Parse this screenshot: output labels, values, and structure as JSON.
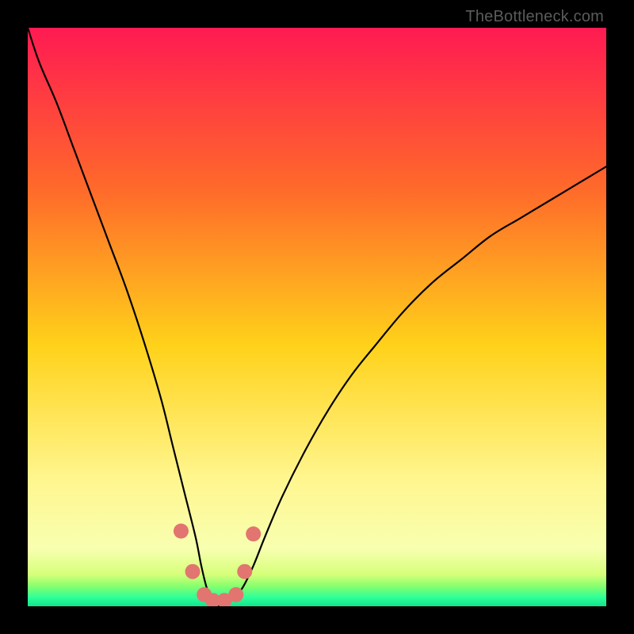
{
  "watermark": "TheBottleneck.com",
  "chart_data": {
    "type": "line",
    "title": "",
    "xlabel": "",
    "ylabel": "",
    "xlim": [
      0,
      100
    ],
    "ylim": [
      0,
      100
    ],
    "gradient_stops": [
      {
        "offset": 0,
        "color": "#ff1a52"
      },
      {
        "offset": 0.28,
        "color": "#ff6a2a"
      },
      {
        "offset": 0.55,
        "color": "#ffd21a"
      },
      {
        "offset": 0.78,
        "color": "#fff68f"
      },
      {
        "offset": 0.9,
        "color": "#f8ffb0"
      },
      {
        "offset": 0.945,
        "color": "#d7ff7a"
      },
      {
        "offset": 0.965,
        "color": "#88ff6e"
      },
      {
        "offset": 0.985,
        "color": "#2dff9a"
      },
      {
        "offset": 1.0,
        "color": "#10e58c"
      }
    ],
    "series": [
      {
        "name": "bottleneck-curve",
        "x": [
          0,
          2,
          5,
          8,
          11,
          14,
          17,
          20,
          23,
          25,
          27,
          29,
          30,
          31,
          32,
          33,
          34,
          35,
          37,
          39,
          41,
          44,
          48,
          52,
          56,
          60,
          65,
          70,
          75,
          80,
          85,
          90,
          95,
          100
        ],
        "values": [
          100,
          94,
          87,
          79,
          71,
          63,
          55,
          46,
          36,
          28,
          20,
          12,
          7,
          3,
          1,
          0,
          0,
          1,
          3,
          7,
          12,
          19,
          27,
          34,
          40,
          45,
          51,
          56,
          60,
          64,
          67,
          70,
          73,
          76
        ]
      },
      {
        "name": "dot-markers",
        "x": [
          26.5,
          28.5,
          30.5,
          32.0,
          34.0,
          36.0,
          37.5,
          39.0
        ],
        "values": [
          13.0,
          6.0,
          2.0,
          1.0,
          1.0,
          2.0,
          6.0,
          12.5
        ]
      }
    ],
    "marker_color": "#e2756f",
    "curve_color": "#000000"
  }
}
